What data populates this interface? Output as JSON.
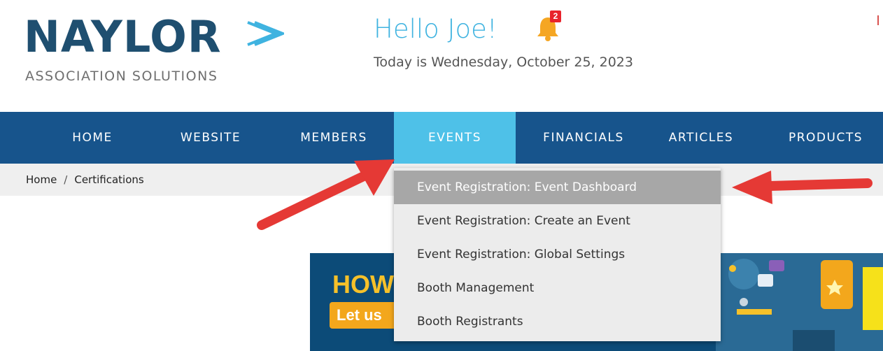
{
  "logo": {
    "wordmark": "NAYLOR",
    "tagline": "ASSOCIATION SOLUTIONS",
    "brand_color": "#1f4f70",
    "chevron_color": "#3fb3e0"
  },
  "header": {
    "greeting": "Hello Joe!",
    "date": "Today is Wednesday, October 25, 2023",
    "notification_icon": "bell-icon",
    "notification_count": "2"
  },
  "nav": {
    "items": [
      {
        "label": "HOME",
        "active": false
      },
      {
        "label": "WEBSITE",
        "active": false
      },
      {
        "label": "MEMBERS",
        "active": false
      },
      {
        "label": "EVENTS",
        "active": true
      },
      {
        "label": "FINANCIALS",
        "active": false
      },
      {
        "label": "ARTICLES",
        "active": false
      },
      {
        "label": "PRODUCTS",
        "active": false
      }
    ],
    "bar_color": "#17548c",
    "active_color": "#4ec1e8"
  },
  "breadcrumb": {
    "items": [
      "Home",
      "Certifications"
    ],
    "separator": "/"
  },
  "events_menu": {
    "items": [
      {
        "label": "Event Registration: Event Dashboard",
        "highlighted": true
      },
      {
        "label": "Event Registration: Create an Event",
        "highlighted": false
      },
      {
        "label": "Event Registration: Global Settings",
        "highlighted": false
      },
      {
        "label": "Booth Management",
        "highlighted": false
      },
      {
        "label": "Booth Registrants",
        "highlighted": false
      }
    ]
  },
  "banner": {
    "headline": "HOW",
    "button_text": "Let us"
  },
  "annotations": {
    "arrow_color": "#e53935"
  }
}
